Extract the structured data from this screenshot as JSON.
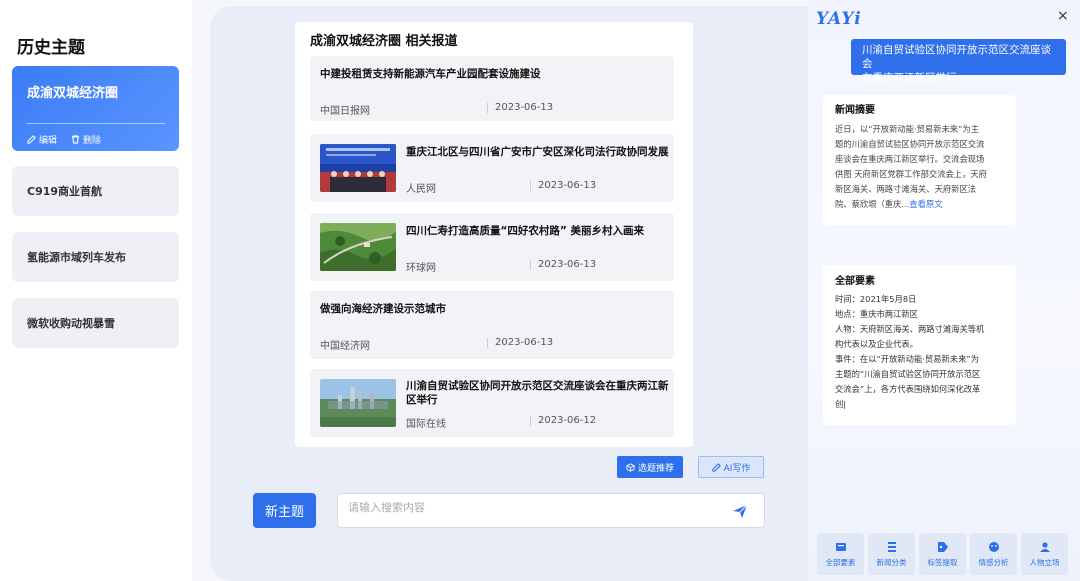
{
  "sidebar": {
    "title": "历史主题",
    "topics": [
      {
        "label": "成渝双城经济圈",
        "edit": "编辑",
        "delete": "删除"
      },
      {
        "label": "C919商业首航"
      },
      {
        "label": "氢能源市域列车发布"
      },
      {
        "label": "微软收购动视暴雪"
      }
    ]
  },
  "main": {
    "heading": "成渝双城经济圈 相关报道",
    "news": [
      {
        "title": "中建投租赁支持新能源汽车产业园配套设施建设",
        "source": "中国日报网",
        "date": "2023-06-13"
      },
      {
        "title": "重庆江北区与四川省广安市广安区深化司法行政协同发展",
        "source": "人民网",
        "date": "2023-06-13"
      },
      {
        "title": "四川仁寿打造高质量“四好农村路” 美丽乡村入画来",
        "source": "环球网",
        "date": "2023-06-13"
      },
      {
        "title": "做强向海经济建设示范城市",
        "source": "中国经济网",
        "date": "2023-06-13"
      },
      {
        "title_line1": "川渝自贸试验区协同开放示范区交流座谈会在重庆两江新",
        "title_line2": "区举行",
        "source": "国际在线",
        "date": "2023-06-12"
      }
    ],
    "topic_recommend": "选题推荐",
    "ai_write": "AI写作",
    "new_topic": "新主题",
    "search_placeholder": "请输入搜索内容"
  },
  "assistant": {
    "logo": "YAYi",
    "close": "×",
    "bubble_line1": "川渝自贸试验区协同开放示范区交流座谈会",
    "bubble_line2": "在重庆两江新区举行",
    "summary": {
      "heading": "新闻摘要",
      "lines": [
        "近日，以“开放新动能·贸易新未来”为主",
        "题的川渝自贸试验区协同开放示范区交流",
        "座谈会在重庆两江新区举行。交流会现场",
        "供图 天府新区党群工作部交流会上，天府",
        "新区海关、两路寸滩海关、天府新区法"
      ],
      "last_line": "院、蔡欣垠（重庆...",
      "link": "查看原文"
    },
    "elements": {
      "heading": "全部要素",
      "lines": [
        "时间：2021年5月8日",
        "地点：重庆市两江新区",
        "人物：天府新区海关、两路寸滩海关等机",
        "构代表以及企业代表。",
        "事件：在以“开放新动能·贸易新未来”为",
        "主题的“川渝自贸试验区协同开放示范区",
        "交流会”上，各方代表围绕如何深化改革",
        "创|"
      ]
    },
    "tools": [
      "全部要素",
      "新闻分类",
      "标签提取",
      "情感分析",
      "人物立场"
    ]
  },
  "colors": {
    "accent": "#2f6fec",
    "panel": "#e8edf8"
  }
}
